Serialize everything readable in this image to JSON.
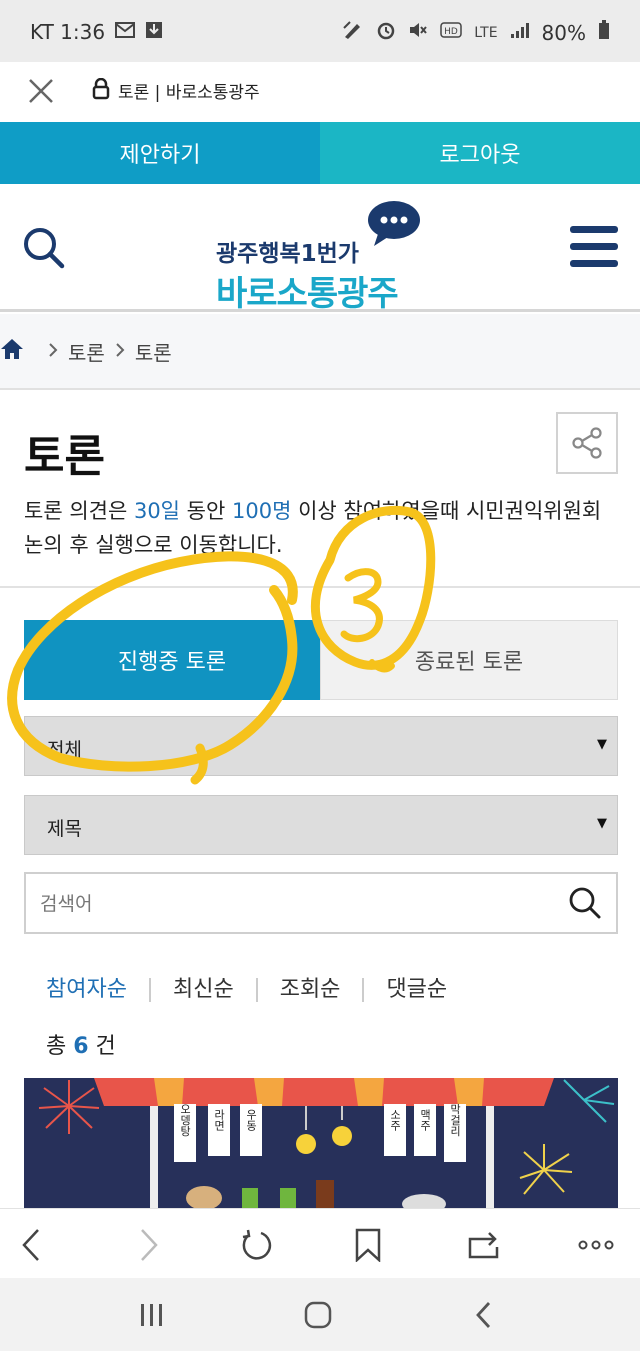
{
  "status_bar": {
    "carrier_time": "KT 1:36",
    "network": "LTE",
    "battery": "80%",
    "icons": [
      "mail-icon",
      "download-icon",
      "pen-icon",
      "alarm-icon",
      "mute-icon",
      "hd-icon",
      "signal-icon",
      "battery-icon"
    ]
  },
  "url_bar": {
    "text": "토론 | 바로소통광주"
  },
  "top_buttons": {
    "propose": "제안하기",
    "logout": "로그아웃"
  },
  "header": {
    "logo_small": "광주행복1번가",
    "logo_big": "바로소통광주"
  },
  "breadcrumb": {
    "items": [
      "토론",
      "토론"
    ]
  },
  "page": {
    "title": "토론",
    "desc_1": "토론 의견은 ",
    "desc_days": "30일",
    "desc_2": " 동안 ",
    "desc_people": "100명",
    "desc_3": " 이상 참여하였을때 시민권익위원회 논의 후 실행으로 이동합니다."
  },
  "tabs": {
    "active": "진행중 토론",
    "inactive": "종료된 토론"
  },
  "filters": {
    "category_value": "전체",
    "field_value": "제목",
    "search_placeholder": "검색어"
  },
  "sort": {
    "options": [
      "참여자순",
      "최신순",
      "조회순",
      "댓글순"
    ]
  },
  "count": {
    "prefix": "총 ",
    "value": "6",
    "suffix": " 건"
  },
  "thumbnail": {
    "signs": [
      "오뎅탕",
      "라면",
      "우동",
      "소주",
      "맥주",
      "막걸리"
    ]
  },
  "annotation": {
    "label": "3",
    "color": "#f6c21b"
  },
  "colors": {
    "primary_blue": "#1093c1",
    "teal": "#1bb6c5",
    "highlight": "#1f6fb4",
    "navy": "#1b3a6d"
  }
}
